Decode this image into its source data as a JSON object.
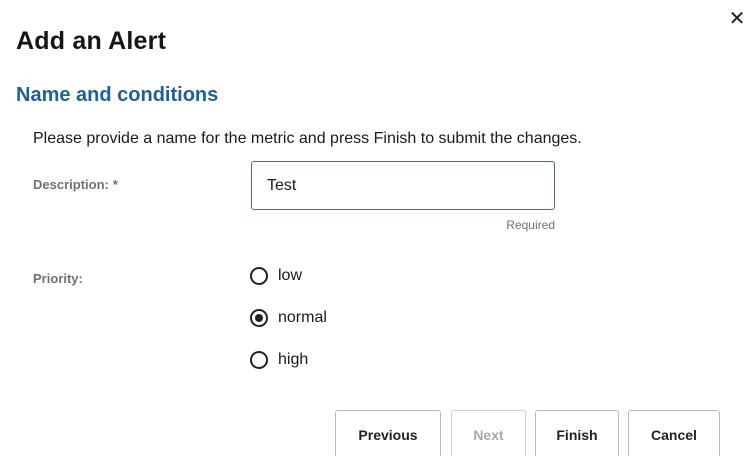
{
  "dialog": {
    "title": "Add an Alert",
    "close_glyph": "✕"
  },
  "section": {
    "title": "Name and conditions",
    "instructions": "Please provide a name for the metric and press Finish to submit the changes."
  },
  "form": {
    "description": {
      "label": "Description:",
      "required_marker": "*",
      "value": "Test",
      "hint": "Required"
    },
    "priority": {
      "label": "Priority:",
      "options": [
        {
          "label": "low",
          "selected": false
        },
        {
          "label": "normal",
          "selected": true
        },
        {
          "label": "high",
          "selected": false
        }
      ]
    }
  },
  "buttons": {
    "previous": "Previous",
    "next": "Next",
    "finish": "Finish",
    "cancel": "Cancel"
  },
  "colors": {
    "section_title": "#1f5f9a",
    "input_border": "#4a7a4a",
    "disabled_text": "#a8a8a8"
  }
}
